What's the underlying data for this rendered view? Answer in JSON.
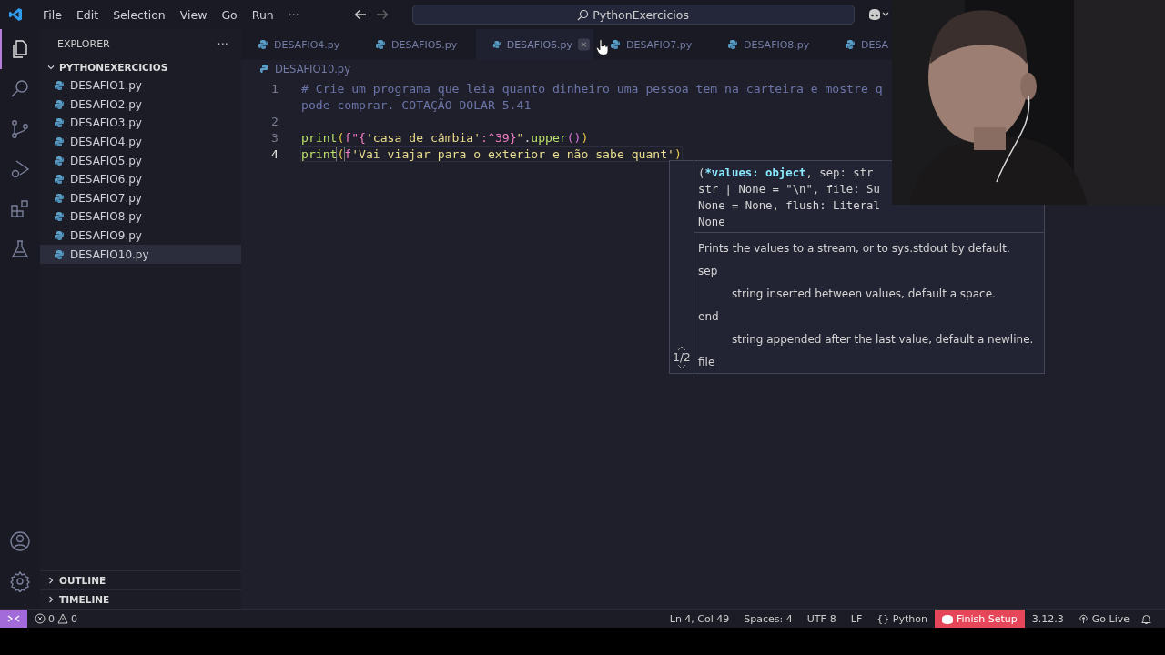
{
  "menu": [
    "File",
    "Edit",
    "Selection",
    "View",
    "Go",
    "Run",
    "···"
  ],
  "command_center": {
    "text": "PythonExercicios"
  },
  "activity_bar": [
    {
      "selected": true
    },
    {
      "selected": false
    },
    {
      "selected": false
    },
    {
      "selected": false
    },
    {
      "selected": false
    },
    {
      "selected": false
    }
  ],
  "sidebar": {
    "title": "EXPLORER",
    "more": "···",
    "folder": {
      "name": "PYTHONEXERCICIOS",
      "expanded": true,
      "files": [
        {
          "name": "DESAFIO1.py",
          "selected": false
        },
        {
          "name": "DESAFIO2.py",
          "selected": false
        },
        {
          "name": "DESAFIO3.py",
          "selected": false
        },
        {
          "name": "DESAFIO4.py",
          "selected": false
        },
        {
          "name": "DESAFIO5.py",
          "selected": false
        },
        {
          "name": "DESAFIO6.py",
          "selected": false
        },
        {
          "name": "DESAFIO7.py",
          "selected": false
        },
        {
          "name": "DESAFIO8.py",
          "selected": false
        },
        {
          "name": "DESAFIO9.py",
          "selected": false
        },
        {
          "name": "DESAFIO10.py",
          "selected": true
        }
      ]
    },
    "sections": [
      {
        "name": "OUTLINE",
        "expanded": false
      },
      {
        "name": "TIMELINE",
        "expanded": false
      }
    ]
  },
  "tabs": [
    {
      "label": "DESAFIO4.py",
      "hovered": false
    },
    {
      "label": "DESAFIO5.py",
      "hovered": false
    },
    {
      "label": "DESAFIO6.py",
      "hovered": true
    },
    {
      "label": "DESAFIO7.py",
      "hovered": false
    },
    {
      "label": "DESAFIO8.py",
      "hovered": false
    },
    {
      "label": "DESA",
      "hovered": false
    }
  ],
  "breadcrumb": "DESAFIO10.py",
  "code": [
    {
      "number": "1",
      "tokens": [
        {
          "kind": "comment",
          "text": "# Crie um programa que leia quanto dinheiro uma pessoa tem na carteira e mostre q"
        }
      ]
    },
    {
      "tokens": [
        {
          "kind": "comment",
          "text": "pode comprar. COTAÇÃO DOLAR 5.41"
        }
      ]
    },
    {
      "number": "2"
    },
    {
      "number": "3",
      "tokens": [
        {
          "kind": "func",
          "text": "print"
        },
        {
          "kind": "paren",
          "text": "("
        },
        {
          "kind": "keyword",
          "text": "f\"{"
        },
        {
          "kind": "string",
          "text": "'casa de câmbia'"
        },
        {
          "kind": "keyword",
          "text": ":^39}"
        },
        {
          "kind": "string",
          "text": "\""
        },
        {
          "kind": "plain",
          "text": "."
        },
        {
          "kind": "func",
          "text": "upper"
        },
        {
          "kind": "paren2",
          "text": "()"
        },
        {
          "kind": "paren",
          "text": ")"
        }
      ]
    },
    {
      "number": "4",
      "current": true,
      "tokens": [
        {
          "kind": "func",
          "text": "print"
        },
        {
          "kind": "match",
          "text": "("
        },
        {
          "kind": "keyword",
          "text": "f"
        },
        {
          "kind": "string",
          "text": "'Vai viajar para o exterior e não sabe quant'"
        },
        {
          "kind": "match",
          "text": ")"
        }
      ]
    }
  ],
  "hover": {
    "signature": [
      [
        {
          "kind": "plain",
          "text": "("
        },
        {
          "kind": "param",
          "text": "*values: object"
        },
        {
          "kind": "plain",
          "text": ", sep: str"
        }
      ],
      [
        {
          "kind": "plain",
          "text": "str | None = \"\\n\", file: Su"
        }
      ],
      [
        {
          "kind": "plain",
          "text": "None = None, flush: Literal"
        }
      ],
      [
        {
          "kind": "plain",
          "text": "None"
        }
      ]
    ],
    "pager": "1/2",
    "docs": [
      {
        "kind": "text",
        "text": "Prints the values to a stream, or to sys.stdout by default."
      },
      {
        "kind": "term",
        "text": "sep"
      },
      {
        "kind": "desc",
        "text": "string inserted between values, default a space."
      },
      {
        "kind": "term",
        "text": "end"
      },
      {
        "kind": "desc",
        "text": "string appended after the last value, default a newline."
      },
      {
        "kind": "term",
        "text": "file"
      }
    ]
  },
  "status_bar": {
    "errors": "0",
    "warnings": "0",
    "right": [
      {
        "kind": "text",
        "text": "Ln 4, Col 49"
      },
      {
        "kind": "text",
        "text": "Spaces: 4"
      },
      {
        "kind": "text",
        "text": "UTF-8"
      },
      {
        "kind": "text",
        "text": "LF"
      },
      {
        "kind": "language",
        "icon": "{}",
        "text": "Python"
      },
      {
        "kind": "setup",
        "text": "Finish Setup"
      },
      {
        "kind": "text",
        "text": "3.12.3"
      },
      {
        "kind": "live",
        "text": "Go Live"
      },
      {
        "kind": "bell"
      }
    ]
  }
}
